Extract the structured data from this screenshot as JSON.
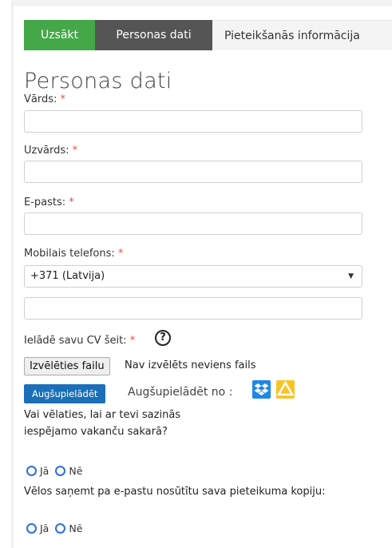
{
  "tabs": [
    {
      "label": "Uzsākt"
    },
    {
      "label": "Personas dati"
    },
    {
      "label": "Pieteikšanās informācija"
    }
  ],
  "section_title": "Personas dati",
  "required_marker": "*",
  "fields": {
    "first_name": {
      "label": "Vārds:",
      "value": ""
    },
    "last_name": {
      "label": "Uzvārds:",
      "value": ""
    },
    "email": {
      "label": "E-pasts:",
      "value": ""
    },
    "mobile": {
      "label": "Mobilais telefons:",
      "country_code": "+371 (Latvija)",
      "value": ""
    }
  },
  "cv": {
    "label": "Ielādē savu CV šeit:",
    "help_glyph": "?",
    "choose_file_label": "Izvēlēties failu",
    "file_status": "Nav izvēlēts neviens fails",
    "upload_button": "Augšupielādēt",
    "upload_from": "Augšupielādēt no :"
  },
  "contact_question": {
    "line1": "Vai vēlaties, lai ar tevi sazinās",
    "line2": "iespējamo vakanču sakarā?",
    "yes": "Jā",
    "no": "Nē"
  },
  "copy_question": {
    "text": "Vēlos saņemt pa e-pastu nosūtītu sava pieteikuma kopiju:",
    "yes": "Jā",
    "no": "Nē"
  },
  "icons": {
    "dropbox": "dropbox-icon",
    "google_drive": "google-drive-icon"
  },
  "colors": {
    "accent_green": "#44a849",
    "active_tab": "#555555",
    "primary_blue": "#1a6fb8",
    "required": "#d9534f"
  }
}
